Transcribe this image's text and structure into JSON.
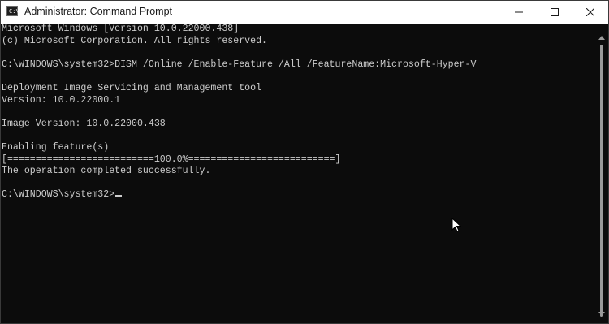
{
  "window": {
    "title": "Administrator: Command Prompt",
    "app_icon_glyph": "C:\\",
    "icons": {
      "app": "cmd-icon",
      "minimize": "minimize-icon",
      "maximize": "maximize-icon",
      "close": "close-icon"
    }
  },
  "console": {
    "lines": [
      "Microsoft Windows [Version 10.0.22000.438]",
      "(c) Microsoft Corporation. All rights reserved.",
      "",
      "C:\\WINDOWS\\system32>DISM /Online /Enable-Feature /All /FeatureName:Microsoft-Hyper-V",
      "",
      "Deployment Image Servicing and Management tool",
      "Version: 10.0.22000.1",
      "",
      "Image Version: 10.0.22000.438",
      "",
      "Enabling feature(s)",
      "[==========================100.0%==========================]",
      "The operation completed successfully.",
      "",
      "C:\\WINDOWS\\system32>"
    ]
  },
  "colors": {
    "console_background": "#0c0c0c",
    "console_text": "#cccccc",
    "titlebar_background": "#ffffff"
  }
}
